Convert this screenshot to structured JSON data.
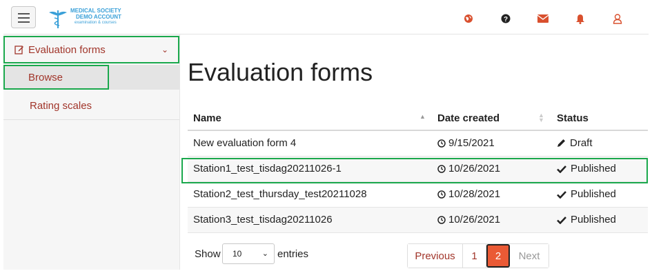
{
  "header": {
    "logo": {
      "line1": "MEDICAL SOCIETY",
      "line2": "DEMO ACCOUNT",
      "line3": "examination & courses"
    },
    "icons": [
      "globe-icon",
      "help-icon",
      "mail-icon",
      "bell-icon",
      "user-icon"
    ],
    "accent_color": "#d9502e"
  },
  "sidebar": {
    "items": [
      {
        "label": "Evaluation forms",
        "icon": "edit-icon",
        "expanded": true
      },
      {
        "label": "Browse",
        "active": true
      },
      {
        "label": "Rating scales"
      }
    ]
  },
  "main": {
    "title": "Evaluation forms",
    "table": {
      "columns": [
        "Name",
        "Date created",
        "Status"
      ],
      "rows": [
        {
          "name": "New evaluation form 4",
          "date": "9/15/2021",
          "status": "Draft",
          "status_icon": "pencil-icon"
        },
        {
          "name": "Station1_test_tisdag20211026-1",
          "date": "10/26/2021",
          "status": "Published",
          "status_icon": "check-icon"
        },
        {
          "name": "Station2_test_thursday_test20211028",
          "date": "10/28/2021",
          "status": "Published",
          "status_icon": "check-icon"
        },
        {
          "name": "Station3_test_tisdag20211026",
          "date": "10/26/2021",
          "status": "Published",
          "status_icon": "check-icon"
        }
      ]
    },
    "footer": {
      "show_label": "Show",
      "entries_value": "10",
      "entries_label": "entries",
      "pagination": {
        "previous": "Previous",
        "pages": [
          "1",
          "2"
        ],
        "current": "2",
        "next": "Next"
      }
    }
  },
  "colors": {
    "brand": "#a1352a",
    "active_page": "#ea5a35",
    "highlight": "#1aa84c"
  }
}
